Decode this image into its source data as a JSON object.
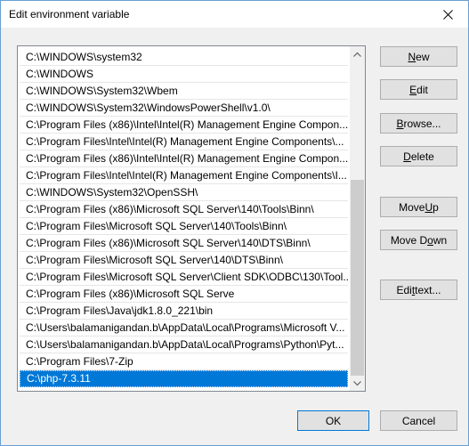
{
  "window": {
    "title": "Edit environment variable",
    "close_label": "Close"
  },
  "list": {
    "items": [
      "C:\\WINDOWS\\system32",
      "C:\\WINDOWS",
      "C:\\WINDOWS\\System32\\Wbem",
      "C:\\WINDOWS\\System32\\WindowsPowerShell\\v1.0\\",
      "C:\\Program Files (x86)\\Intel\\Intel(R) Management Engine Compon...",
      "C:\\Program Files\\Intel\\Intel(R) Management Engine Components\\...",
      "C:\\Program Files (x86)\\Intel\\Intel(R) Management Engine Compon...",
      "C:\\Program Files\\Intel\\Intel(R) Management Engine Components\\I...",
      "C:\\WINDOWS\\System32\\OpenSSH\\",
      "C:\\Program Files (x86)\\Microsoft SQL Server\\140\\Tools\\Binn\\",
      "C:\\Program Files\\Microsoft SQL Server\\140\\Tools\\Binn\\",
      "C:\\Program Files (x86)\\Microsoft SQL Server\\140\\DTS\\Binn\\",
      "C:\\Program Files\\Microsoft SQL Server\\140\\DTS\\Binn\\",
      "C:\\Program Files\\Microsoft SQL Server\\Client SDK\\ODBC\\130\\Tool...",
      "C:\\Program Files (x86)\\Microsoft SQL Serve",
      "C:\\Program Files\\Java\\jdk1.8.0_221\\bin",
      "C:\\Users\\balamanigandan.b\\AppData\\Local\\Programs\\Microsoft V...",
      "C:\\Users\\balamanigandan.b\\AppData\\Local\\Programs\\Python\\Pyt...",
      "C:\\Program Files\\7-Zip",
      "C:\\php-7.3.11"
    ],
    "selected_index": 19
  },
  "buttons": {
    "new": {
      "pre": "",
      "accel": "N",
      "post": "ew"
    },
    "edit": {
      "pre": "",
      "accel": "E",
      "post": "dit"
    },
    "browse": {
      "pre": "",
      "accel": "B",
      "post": "rowse..."
    },
    "delete": {
      "pre": "",
      "accel": "D",
      "post": "elete"
    },
    "move_up": {
      "pre": "Move ",
      "accel": "U",
      "post": "p"
    },
    "move_down": {
      "pre": "Move D",
      "accel": "o",
      "post": "wn"
    },
    "edit_text": {
      "pre": "Edi",
      "accel": "t",
      "post": " text..."
    },
    "ok": "OK",
    "cancel": "Cancel"
  },
  "colors": {
    "selection": "#0078d7",
    "accent_border": "#0078d7"
  }
}
